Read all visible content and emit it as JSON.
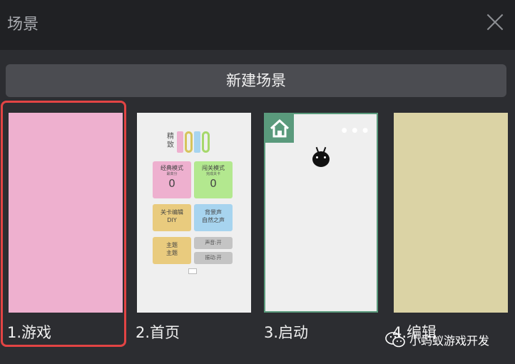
{
  "header": {
    "title": "场景"
  },
  "toolbar": {
    "new_scene_label": "新建场景"
  },
  "scenes": [
    {
      "label": "1.游戏",
      "color": "#eeb0cf",
      "selected": true
    },
    {
      "label": "2.首页",
      "color": "#efefef",
      "selected": false
    },
    {
      "label": "3.启动",
      "color": "#efefef",
      "selected": false
    },
    {
      "label": "4.编辑",
      "color": "#dbd3a5",
      "selected": false
    }
  ],
  "index_preview": {
    "logo_cn": "精致",
    "tiles": [
      {
        "title": "经典模式",
        "sub": "最高分",
        "value": "0",
        "color": "#eeb0cf"
      },
      {
        "title": "闯关模式",
        "sub": "完成关卡",
        "value": "0",
        "color": "#b3e88f"
      },
      {
        "title": "关卡编辑",
        "sub": "DIY",
        "color": "#e9cb7e"
      },
      {
        "title": "背景声",
        "sub": "自然之声",
        "color": "#a7d4ef"
      },
      {
        "title": "主题",
        "sub": "主题",
        "color": "#e9cb7e"
      }
    ],
    "small_tiles": [
      "声音:开",
      "振动:开"
    ]
  },
  "watermark": {
    "text": "小蚂蚁游戏开发"
  },
  "colors": {
    "selection_border": "#e24444",
    "start_border": "#5a9a7c"
  }
}
